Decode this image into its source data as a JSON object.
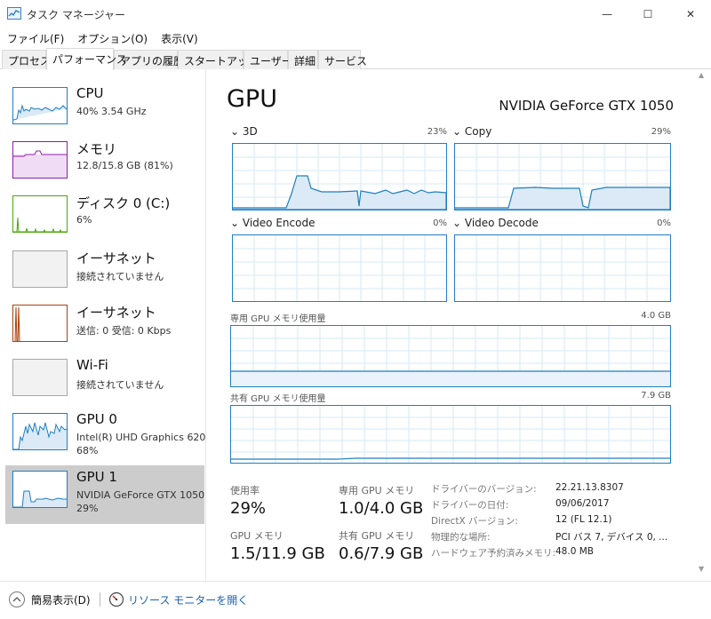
{
  "window": {
    "title": "タスク マネージャー",
    "minimize_glyph": "—",
    "maximize_glyph": "☐",
    "close_glyph": "✕"
  },
  "menu": [
    "ファイル(F)",
    "オプション(O)",
    "表示(V)"
  ],
  "tabs": [
    "プロセス",
    "パフォーマンス",
    "アプリの履歴",
    "スタートアップ",
    "ユーザー",
    "詳細",
    "サービス"
  ],
  "active_tab": "パフォーマンス",
  "sidebar": [
    {
      "name": "CPU",
      "sub1": "40%  3.54 GHz",
      "sub2": "",
      "color": "#1f7fc3",
      "selected": false
    },
    {
      "name": "メモリ",
      "sub1": "12.8/15.8 GB (81%)",
      "sub2": "",
      "color": "#8b1fa9",
      "selected": false
    },
    {
      "name": "ディスク 0 (C:)",
      "sub1": "6%",
      "sub2": "",
      "color": "#4da60c",
      "selected": false
    },
    {
      "name": "イーサネット",
      "sub1": "接続されていません",
      "sub2": "",
      "color": "#a7a7a7",
      "selected": false
    },
    {
      "name": "イーサネット",
      "sub1": "送信: 0  受信: 0 Kbps",
      "sub2": "",
      "color": "#a7410c",
      "selected": false
    },
    {
      "name": "Wi-Fi",
      "sub1": "接続されていません",
      "sub2": "",
      "color": "#a7a7a7",
      "selected": false
    },
    {
      "name": "GPU 0",
      "sub1": "Intel(R) UHD Graphics 620",
      "sub2": "68%",
      "color": "#1f7fc3",
      "selected": false
    },
    {
      "name": "GPU 1",
      "sub1": "NVIDIA GeForce GTX 1050",
      "sub2": "29%",
      "color": "#1f7fc3",
      "selected": true
    }
  ],
  "main": {
    "title": "GPU",
    "model": "NVIDIA GeForce GTX 1050",
    "engines": [
      {
        "label": "3D",
        "pct": "23%"
      },
      {
        "label": "Copy",
        "pct": "29%"
      },
      {
        "label": "Video Encode",
        "pct": "0%"
      },
      {
        "label": "Video Decode",
        "pct": "0%"
      }
    ],
    "dedicated_label": "専用 GPU メモリ使用量",
    "dedicated_max": "4.0 GB",
    "shared_label": "共有 GPU メモリ使用量",
    "shared_max": "7.9 GB",
    "stats": {
      "utilization_label": "使用率",
      "utilization_value": "29%",
      "dedicated_mem_label": "専用 GPU メモリ",
      "dedicated_mem_value": "1.0/4.0 GB",
      "gpu_mem_label": "GPU メモリ",
      "gpu_mem_value": "1.5/11.9 GB",
      "shared_mem_label": "共有 GPU メモリ",
      "shared_mem_value": "0.6/7.9 GB"
    },
    "info": [
      {
        "key": "ドライバーのバージョン:",
        "value": "22.21.13.8307"
      },
      {
        "key": "ドライバーの日付:",
        "value": "09/06/2017"
      },
      {
        "key": "DirectX バージョン:",
        "value": "12 (FL 12.1)"
      },
      {
        "key": "物理的な場所:",
        "value": "PCI バス 7, デバイス 0, ..."
      },
      {
        "key": "ハードウェア予約済みメモリ:",
        "value": "48.0 MB"
      }
    ]
  },
  "footer": {
    "fewer_details": "簡易表示(D)",
    "resource_monitor": "リソース モニターを開く"
  },
  "colors": {
    "accent": "#1f7fc3",
    "memory": "#8b1fa9",
    "disk": "#4da60c",
    "ethernet": "#a7410c",
    "selected_bg": "#cccccc"
  }
}
